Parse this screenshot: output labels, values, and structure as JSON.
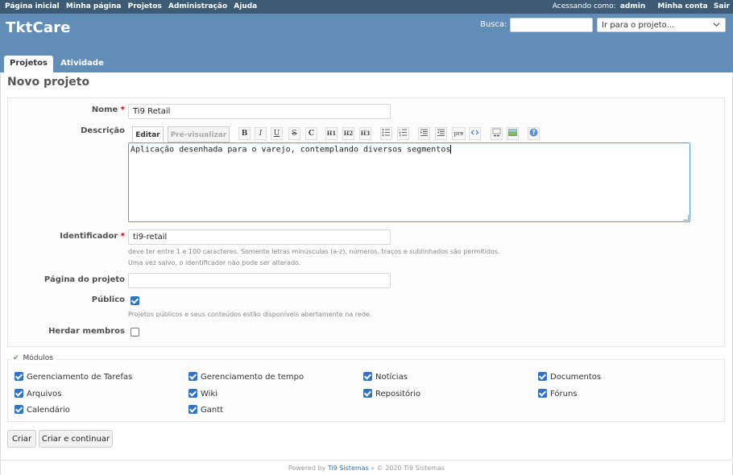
{
  "top_menu": {
    "items": [
      "Página inicial",
      "Minha página",
      "Projetos",
      "Administração",
      "Ajuda"
    ],
    "logged_prefix": "Acessando como:",
    "user": "admin",
    "my_account": "Minha conta",
    "logout": "Sair"
  },
  "header": {
    "title": "TktCare",
    "search_label": "Busca:",
    "search_value": "",
    "jump_label": "Ir para o projeto..."
  },
  "tabs": [
    "Projetos",
    "Atividade"
  ],
  "page_title": "Novo projeto",
  "form": {
    "name_label": "Nome",
    "name_value": "Ti9 Retail",
    "description_label": "Descrição",
    "editor_tabs": [
      "Editar",
      "Pré-visualizar"
    ],
    "toolbar": [
      "B",
      "I",
      "U",
      "S",
      "C",
      "H1",
      "H2",
      "H3",
      "pre"
    ],
    "description_value": "Aplicação desenhada para o varejo, contemplando diversos segmentos",
    "identifier_label": "Identificador",
    "identifier_value": "ti9-retail",
    "identifier_hint_1": "deve ter entre 1 e 100 caracteres. Somente letras minúsculas (a-z), números, traços e sublinhados são permitidos.",
    "identifier_hint_2": "Uma vez salvo, o identificador não pode ser alterado.",
    "homepage_label": "Página do projeto",
    "homepage_value": "",
    "public_label": "Público",
    "public_checked": true,
    "public_hint": "Projetos públicos e seus conteúdos estão disponíveis abertamente na rede.",
    "inherit_label": "Herdar membros",
    "inherit_checked": false,
    "required_marker": "*"
  },
  "modules": {
    "legend": "Módulos",
    "items": [
      {
        "label": "Gerenciamento de Tarefas",
        "checked": true
      },
      {
        "label": "Gerenciamento de tempo",
        "checked": true
      },
      {
        "label": "Notícias",
        "checked": true
      },
      {
        "label": "Documentos",
        "checked": true
      },
      {
        "label": "Arquivos",
        "checked": true
      },
      {
        "label": "Wiki",
        "checked": true
      },
      {
        "label": "Repositório",
        "checked": true
      },
      {
        "label": "Fóruns",
        "checked": true
      },
      {
        "label": "Calendário",
        "checked": true
      },
      {
        "label": "Gantt",
        "checked": true
      }
    ]
  },
  "buttons": {
    "create": "Criar",
    "create_continue": "Criar e continuar"
  },
  "footer": {
    "powered_by": "Powered by",
    "link": "Ti9 Sistemas",
    "copyright": "» © 2020 Ti9 Sistemas"
  },
  "colors": {
    "top_menu": "#3e5b76",
    "header": "#628db6",
    "checkbox": "#2f73c7",
    "required": "#bb0000"
  }
}
